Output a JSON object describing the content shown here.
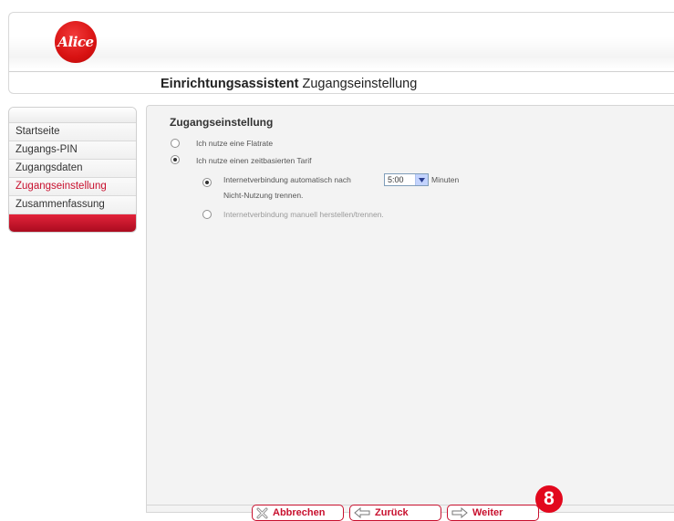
{
  "header": {
    "logo_text": "Alice",
    "title_bold": "Einrichtungsassistent",
    "title_rest": " Zugangseinstellung"
  },
  "sidebar": {
    "items": [
      {
        "label": "Startseite",
        "active": false
      },
      {
        "label": "Zugangs-PIN",
        "active": false
      },
      {
        "label": "Zugangsdaten",
        "active": false
      },
      {
        "label": "Zugangseinstellung",
        "active": true
      },
      {
        "label": "Zusammenfassung",
        "active": false
      }
    ]
  },
  "main": {
    "section_title": "Zugangseinstellung",
    "option_flatrate": "Ich nutze eine Flatrate",
    "option_tarif": "Ich nutze einen zeitbasierten Tarif",
    "sub_auto_prefix": "Internetverbindung automatisch nach",
    "sub_auto_suffix": "Minuten",
    "sub_auto_line2": "Nicht-Nutzung trennen.",
    "timeout_value": "5:00",
    "sub_manual": "Internetverbindung manuell herstellen/trennen."
  },
  "footer": {
    "cancel_label": "Abbrechen",
    "back_label": "Zurück",
    "next_label": "Weiter",
    "step_badge": "8"
  },
  "colors": {
    "accent": "#c8102e",
    "badge": "#e2081d"
  }
}
